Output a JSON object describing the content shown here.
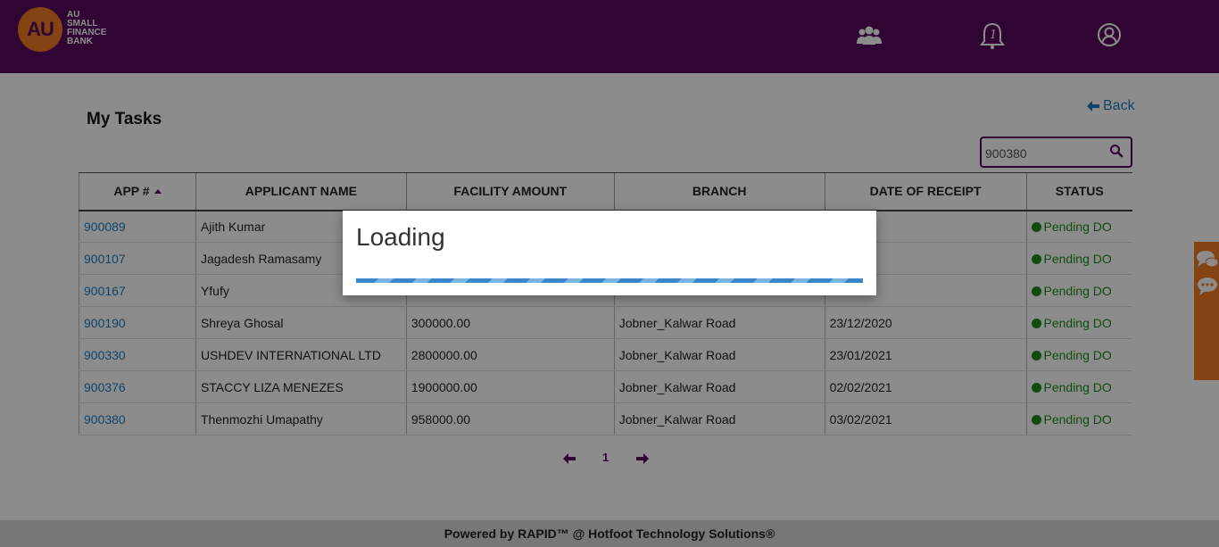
{
  "header": {
    "logo": {
      "mark": "AU",
      "line1": "AU",
      "line2": "SMALL",
      "line3": "FINANCE",
      "line4": "BANK"
    },
    "icons": [
      "users-icon",
      "bell-icon",
      "user-account-icon"
    ],
    "notification_count": "1"
  },
  "page": {
    "title": "My Tasks",
    "back_label": "Back",
    "search_value": "900380"
  },
  "table": {
    "columns": [
      "APP #",
      "APPLICANT NAME",
      "FACILITY AMOUNT",
      "BRANCH",
      "DATE OF RECEIPT",
      "STATUS"
    ],
    "rows": [
      {
        "app": "900089",
        "name": "Ajith Kumar",
        "amount": "",
        "branch": "",
        "date": "020",
        "status": "Pending DO"
      },
      {
        "app": "900107",
        "name": "Jagadesh Ramasamy",
        "amount": "",
        "branch": "",
        "date": "020",
        "status": "Pending DO"
      },
      {
        "app": "900167",
        "name": "Yfufy",
        "amount": "",
        "branch": "",
        "date": "020",
        "status": "Pending DO"
      },
      {
        "app": "900190",
        "name": "Shreya Ghosal",
        "amount": "300000.00",
        "branch": "Jobner_Kalwar Road",
        "date": "23/12/2020",
        "status": "Pending DO"
      },
      {
        "app": "900330",
        "name": "USHDEV INTERNATIONAL LTD",
        "amount": "2800000.00",
        "branch": "Jobner_Kalwar Road",
        "date": "23/01/2021",
        "status": "Pending DO"
      },
      {
        "app": "900376",
        "name": "STACCY LIZA MENEZES",
        "amount": "1900000.00",
        "branch": "Jobner_Kalwar Road",
        "date": "02/02/2021",
        "status": "Pending DO"
      },
      {
        "app": "900380",
        "name": "Thenmozhi Umapathy",
        "amount": "958000.00",
        "branch": "Jobner_Kalwar Road",
        "date": "03/02/2021",
        "status": "Pending DO"
      }
    ]
  },
  "pager": {
    "current_page": "1"
  },
  "footer": {
    "text": "Powered by RAPID™ @ Hotfoot Technology Solutions®"
  },
  "modal": {
    "title": "Loading"
  },
  "colors": {
    "brand_purple": "#5a0a5e",
    "brand_orange": "#f07b22",
    "link_blue": "#1a7cc1",
    "status_green": "#1e8a1e"
  }
}
